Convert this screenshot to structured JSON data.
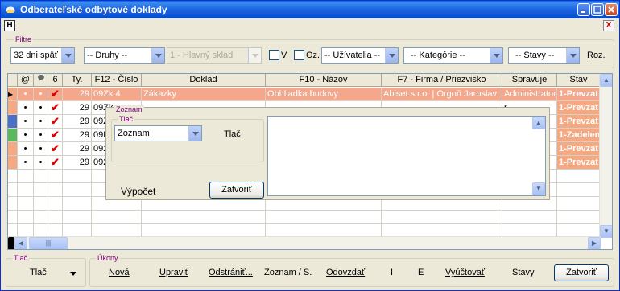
{
  "window": {
    "title": "Odberateľské odbytové doklady",
    "h_button": "H",
    "close_x": "X"
  },
  "filters": {
    "group_label": "Filtre",
    "period": "32 dni späť",
    "kinds": "-- Druhy --",
    "warehouse": "1 - Hlavný sklad",
    "check_v_label": "V",
    "check_oz_label": "Oz.",
    "users": "-- Užívatelia --",
    "categories": "-- Kategórie --",
    "states": "-- Stavy --",
    "roz": "Roz."
  },
  "grid": {
    "headers": [
      "",
      "@",
      "",
      "6",
      "Ty.",
      "F12 - Číslo",
      "Doklad",
      "F10 - Názov",
      "F7 - Firma / Priezvisko",
      "Spravuje",
      "Stav"
    ],
    "rows": [
      {
        "ty": "29",
        "cislo": "09Zk 4",
        "doklad": "Zákazky",
        "nazov": "Obhliadka budovy",
        "firma": "Abiset s.r.o. | Orgoň Jaroslav",
        "spravuje": "Administrator",
        "stav": "1-Prevzat",
        "marker": "#f4a983"
      },
      {
        "ty": "29",
        "cislo": "09Zk",
        "doklad": "",
        "nazov": "",
        "firma": "",
        "spravuje": "r",
        "stav": "1-Prevzat",
        "marker": "#f4a983"
      },
      {
        "ty": "29",
        "cislo": "09Z",
        "doklad": "",
        "nazov": "",
        "firma": "",
        "spravuje": "r",
        "stav": "1-Prevzat",
        "marker": "#4a6fc8"
      },
      {
        "ty": "29",
        "cislo": "09P",
        "doklad": "",
        "nazov": "",
        "firma": "",
        "spravuje": "r",
        "stav": "1-Zadelen",
        "marker": "#5cb85c"
      },
      {
        "ty": "29",
        "cislo": "092",
        "doklad": "",
        "nazov": "",
        "firma": "",
        "spravuje": "r",
        "stav": "1-Prevzat",
        "marker": "#f4a983"
      },
      {
        "ty": "29",
        "cislo": "092",
        "doklad": "",
        "nazov": "",
        "firma": "",
        "spravuje": "r",
        "stav": "1-Prevzat",
        "marker": "#f4a983"
      }
    ]
  },
  "popup": {
    "group_label": "Zoznam",
    "inner_label": "Tlač",
    "select_value": "Zoznam",
    "print_label": "Tlač",
    "calc_label": "Výpočet",
    "close_button": "Zatvoriť"
  },
  "bottom": {
    "print_group": "Tlač",
    "print_button": "Tlač",
    "actions_group": "Úkony",
    "actions": [
      "Nová",
      "Upraviť",
      "Odstrániť...",
      "Zoznam / S.",
      "Odovzdať",
      "I",
      "E",
      "Vyúčtovať",
      "Stavy"
    ],
    "close_button": "Zatvoriť"
  },
  "colors": {
    "titlebar": "#1c64e0",
    "selected_row": "#f4a78a",
    "state_cell": "#f4a983",
    "check_mark": "#dd0000"
  }
}
